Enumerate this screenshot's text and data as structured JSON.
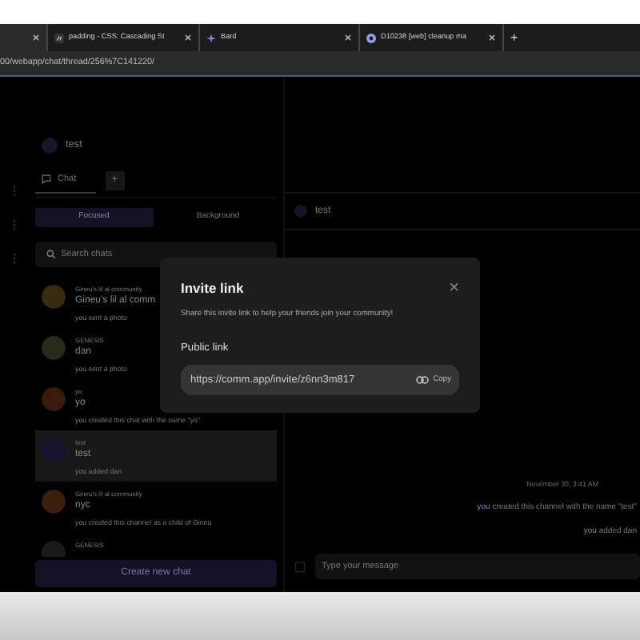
{
  "browser": {
    "tabs": [
      {
        "selected": true
      },
      {
        "title": "padding - CSS: Cascading St",
        "selected": false
      },
      {
        "title": "Bard",
        "selected": false
      },
      {
        "title": "D10238 [web] cleanup ma",
        "selected": false
      }
    ],
    "new_tab": "+",
    "url": "00/webapp/chat/thread/256%7C141220/"
  },
  "sidebar": {
    "community": "test",
    "tabs": [
      {
        "label": "Chat",
        "selected": true
      }
    ],
    "add": "+",
    "filters": [
      {
        "label": "Focused",
        "selected": true
      },
      {
        "label": "Background",
        "selected": false
      }
    ],
    "search": {
      "placeholder": "Search chats"
    },
    "chats": [
      {
        "community": "Gineu's lil al community",
        "name": "Gineu's lil al comm",
        "preview": "you sent a photo",
        "selected": false
      },
      {
        "community": "GENESIS",
        "name": "dan",
        "preview": "you sent a photo",
        "selected": false
      },
      {
        "community": "yo",
        "name": "yo",
        "preview": "you created this chat with the name \"yo\"",
        "selected": false
      },
      {
        "community": "test",
        "name": "test",
        "preview": "you added dan",
        "selected": true
      },
      {
        "community": "Gineu's lil al community",
        "name": "nyc",
        "preview": "you created this channel as a child of Gineu",
        "selected": false
      },
      {
        "community": "GENESIS",
        "selected": false
      }
    ],
    "create_button": "Create new chat"
  },
  "thread": {
    "title": "test",
    "date": "November 30, 3:41 AM",
    "messages": [
      {
        "actor": "you",
        "text": "created this channel with the name \"test\""
      },
      {
        "actor": "you",
        "text": "added dan"
      }
    ],
    "composer": {
      "placeholder": "Type your message"
    }
  },
  "modal": {
    "title": "Invite link",
    "close": "×",
    "description": "Share this invite link to help your friends join your community!",
    "field_label": "Public link",
    "link": "https://comm.app/invite/z6nn3m817",
    "copy": "Copy"
  }
}
